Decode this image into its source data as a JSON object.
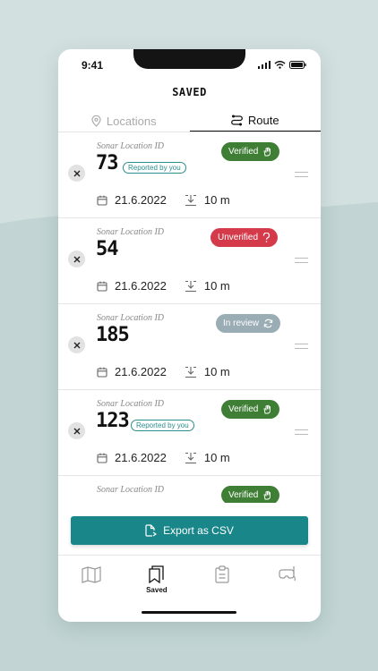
{
  "status_bar": {
    "time": "9:41"
  },
  "header": {
    "title": "SAVED"
  },
  "tabs": [
    {
      "label": "Locations",
      "icon": "location-pin-icon",
      "active": false
    },
    {
      "label": "Route",
      "icon": "route-icon",
      "active": true
    }
  ],
  "items": [
    {
      "label": "Sonar Location ID",
      "id": "73",
      "reported": "Reported by you",
      "status": "Verified",
      "status_icon": "hand-wave-icon",
      "date": "21.6.2022",
      "depth": "10 m"
    },
    {
      "label": "Sonar Location ID",
      "id": "54",
      "reported": "",
      "status": "Unverified",
      "status_icon": "question-icon",
      "date": "21.6.2022",
      "depth": "10 m"
    },
    {
      "label": "Sonar Location ID",
      "id": "185",
      "reported": "",
      "status": "In review",
      "status_icon": "refresh-icon",
      "date": "21.6.2022",
      "depth": "10 m"
    },
    {
      "label": "Sonar Location ID",
      "id": "123",
      "reported": "Reported by you",
      "status": "Verified",
      "status_icon": "hand-wave-icon",
      "date": "21.6.2022",
      "depth": "10 m"
    },
    {
      "label": "Sonar Location ID",
      "id": "",
      "reported": "",
      "status": "Verified",
      "status_icon": "hand-wave-icon",
      "date": "",
      "depth": ""
    }
  ],
  "export": {
    "label": "Export as CSV",
    "icon": "export-file-icon"
  },
  "nav": [
    {
      "label": "",
      "icon": "map-icon"
    },
    {
      "label": "Saved",
      "icon": "bookmarks-icon"
    },
    {
      "label": "",
      "icon": "clipboard-icon"
    },
    {
      "label": "",
      "icon": "diving-mask-icon"
    }
  ],
  "colors": {
    "verified": "#3f7f35",
    "unverified": "#d43a4a",
    "in_review": "#9aacb4",
    "accent": "#19878a",
    "background": "#d3e0e0"
  }
}
